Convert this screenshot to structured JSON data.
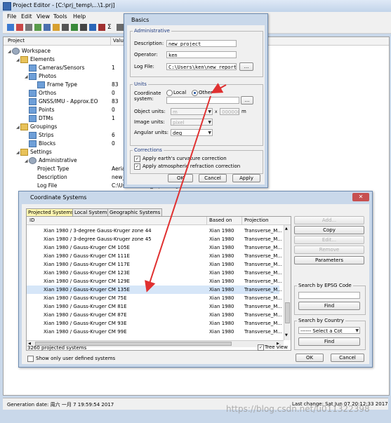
{
  "main": {
    "title": "Project Editor - [C:\\prj_temp\\...\\1.prj]",
    "menu": [
      "File",
      "Edit",
      "View",
      "Tools",
      "Help"
    ],
    "tree_header": {
      "col1": "Project",
      "col2": "Valu"
    },
    "tree": [
      {
        "label": "Workspace",
        "value": "",
        "icon": "gear"
      },
      {
        "label": "Elements",
        "value": "",
        "icon": "folder"
      },
      {
        "label": "Cameras/Sensors",
        "value": "1",
        "icon": "blue"
      },
      {
        "label": "Photos",
        "value": "",
        "icon": "blue"
      },
      {
        "label": "Frame Type",
        "value": "83",
        "icon": "blue"
      },
      {
        "label": "Orthos",
        "value": "0",
        "icon": "blue"
      },
      {
        "label": "GNSS/IMU - Approx.EO",
        "value": "83",
        "icon": "blue"
      },
      {
        "label": "Points",
        "value": "0",
        "icon": "blue"
      },
      {
        "label": "DTMs",
        "value": "1",
        "icon": "blue"
      },
      {
        "label": "Groupings",
        "value": "",
        "icon": "folder"
      },
      {
        "label": "Strips",
        "value": "6",
        "icon": "blue"
      },
      {
        "label": "Blocks",
        "value": "0",
        "icon": "blue"
      },
      {
        "label": "Settings",
        "value": "",
        "icon": "folder"
      },
      {
        "label": "Administrative",
        "value": "",
        "icon": "gear"
      },
      {
        "label": "Project Type",
        "value": "Aeria",
        "icon": ""
      },
      {
        "label": "Description",
        "value": "new_",
        "icon": ""
      },
      {
        "label": "Log File",
        "value": "C:\\User\\...\\new_report.log",
        "icon": ""
      }
    ],
    "status_left": "Generation date: 周六 一月 7 19:59:54 2017",
    "status_right": "Last change: Sat Jun 07 20:12:33 2017",
    "watermark": "https://blog.csdn.net/u011322398"
  },
  "basics": {
    "title": "Basics",
    "admin_group": "Administrative",
    "description_label": "Description:",
    "description_value": "new_project",
    "operator_label": "Operator:",
    "operator_value": "ken",
    "logfile_label": "Log File:",
    "logfile_value": "C:\\Users\\ken\\new_report.log",
    "browse": "...",
    "units_group": "Units",
    "coord_label_1": "Coordinate",
    "coord_label_2": "system:",
    "radio_local": "Local",
    "radio_other": "Other",
    "object_units_label": "Object units:",
    "object_units_value": "m",
    "object_units_num": "000000",
    "object_units_suffix": "m",
    "image_units_label": "Image units:",
    "image_units_value": "pixel",
    "angular_units_label": "Angular units:",
    "angular_units_value": "deg",
    "corrections_group": "Corrections",
    "corr1": "Apply earth's curvature correction",
    "corr2": "Apply atmospheric refraction correction",
    "ok": "OK",
    "cancel": "Cancel",
    "apply": "Apply"
  },
  "cs": {
    "title": "Coordinate Systems",
    "tabs": [
      "Projected Systems",
      "Local Systems",
      "Geographic Systems"
    ],
    "columns": [
      "ID",
      "Based on",
      "Projection"
    ],
    "rows": [
      {
        "id": "Xian 1980 / 3-degree Gauss-Kruger zone 44",
        "based": "Xian 1980",
        "proj": "Transverse_M..."
      },
      {
        "id": "Xian 1980 / 3-degree Gauss-Kruger zone 45",
        "based": "Xian 1980",
        "proj": "Transverse_M..."
      },
      {
        "id": "Xian 1980 / Gauss-Kruger CM 105E",
        "based": "Xian 1980",
        "proj": "Transverse_M..."
      },
      {
        "id": "Xian 1980 / Gauss-Kruger CM 111E",
        "based": "Xian 1980",
        "proj": "Transverse_M..."
      },
      {
        "id": "Xian 1980 / Gauss-Kruger CM 117E",
        "based": "Xian 1980",
        "proj": "Transverse_M..."
      },
      {
        "id": "Xian 1980 / Gauss-Kruger CM 123E",
        "based": "Xian 1980",
        "proj": "Transverse_M..."
      },
      {
        "id": "Xian 1980 / Gauss-Kruger CM 129E",
        "based": "Xian 1980",
        "proj": "Transverse_M..."
      },
      {
        "id": "Xian 1980 / Gauss-Kruger CM 135E",
        "based": "Xian 1980",
        "proj": "Transverse_M..."
      },
      {
        "id": "Xian 1980 / Gauss-Kruger CM 75E",
        "based": "Xian 1980",
        "proj": "Transverse_M..."
      },
      {
        "id": "Xian 1980 / Gauss-Kruger CM 81E",
        "based": "Xian 1980",
        "proj": "Transverse_M..."
      },
      {
        "id": "Xian 1980 / Gauss-Kruger CM 87E",
        "based": "Xian 1980",
        "proj": "Transverse_M..."
      },
      {
        "id": "Xian 1980 / Gauss-Kruger CM 93E",
        "based": "Xian 1980",
        "proj": "Transverse_M..."
      },
      {
        "id": "Xian 1980 / Gauss-Kruger CM 99E",
        "based": "Xian 1980",
        "proj": "Transverse_M..."
      }
    ],
    "count": "3260 projected systems",
    "tree_view": "Tree view",
    "show_user": "Show only user defined systems",
    "btn_add": "Add...",
    "btn_copy": "Copy",
    "btn_edit": "Edit...",
    "btn_remove": "Remove",
    "btn_params": "Parameters",
    "epsg_group": "Search by EPSG Code",
    "find": "Find",
    "country_group": "Search by Country",
    "country_value": "------ Select a Cot",
    "ok": "OK",
    "cancel": "Cancel"
  },
  "colors": {
    "arrow": "#e03030",
    "selection": "#d6e6f8",
    "group_label": "#1d3a80"
  }
}
